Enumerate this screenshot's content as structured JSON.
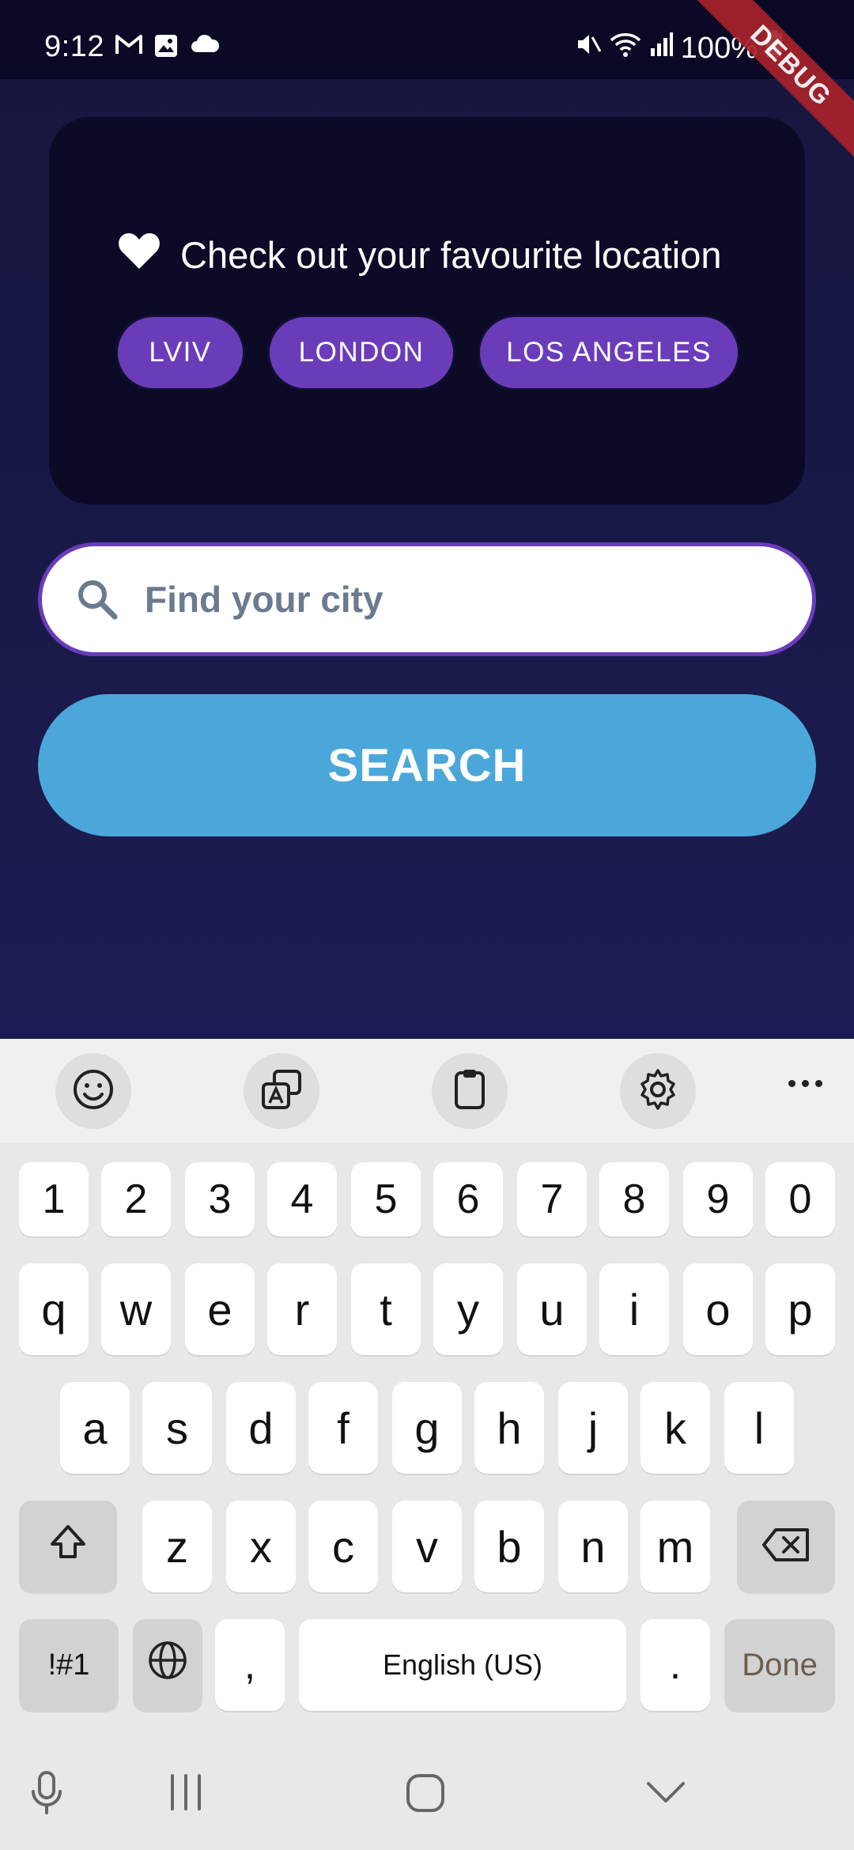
{
  "status_bar": {
    "time": "9:12",
    "battery": "100%"
  },
  "debug_banner": "DEBUG",
  "favourites": {
    "title": "Check out your favourite location",
    "chips": [
      {
        "label": "LVIV"
      },
      {
        "label": "LONDON"
      },
      {
        "label": "LOS ANGELES"
      }
    ]
  },
  "search": {
    "placeholder": "Find your city",
    "button_label": "SEARCH"
  },
  "keyboard": {
    "number_row": [
      "1",
      "2",
      "3",
      "4",
      "5",
      "6",
      "7",
      "8",
      "9",
      "0"
    ],
    "row1": [
      "q",
      "w",
      "e",
      "r",
      "t",
      "y",
      "u",
      "i",
      "o",
      "p"
    ],
    "row2": [
      "a",
      "s",
      "d",
      "f",
      "g",
      "h",
      "j",
      "k",
      "l"
    ],
    "row3": [
      "z",
      "x",
      "c",
      "v",
      "b",
      "n",
      "m"
    ],
    "symbols_label": "!#1",
    "comma": ",",
    "space_label": "English (US)",
    "period": ".",
    "done_label": "Done"
  },
  "colors": {
    "accent": "#6a3cba",
    "search_button": "#4ba7d9",
    "card": "#0b0b27"
  }
}
